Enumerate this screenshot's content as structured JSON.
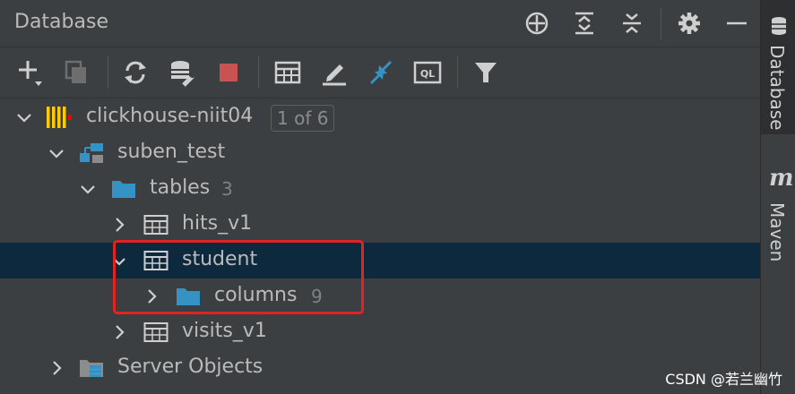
{
  "header": {
    "title": "Database"
  },
  "tree": {
    "connection": {
      "label": "clickhouse-niit04",
      "badge": "1 of 6"
    },
    "schema": {
      "label": "suben_test"
    },
    "tables_folder": {
      "label": "tables",
      "count": "3"
    },
    "tables": [
      {
        "label": "hits_v1"
      },
      {
        "label": "student"
      },
      {
        "label": "visits_v1"
      }
    ],
    "columns_folder": {
      "label": "columns",
      "count": "9"
    },
    "server_objects": {
      "label": "Server Objects"
    }
  },
  "side_tabs": {
    "database": "Database",
    "maven": "Maven",
    "maven_letter": "m"
  },
  "watermark": "CSDN @若兰幽竹",
  "colors": {
    "selection": "#0d293e",
    "accent": "#3592c4",
    "highlight": "#e52222",
    "stop": "#c75450"
  }
}
